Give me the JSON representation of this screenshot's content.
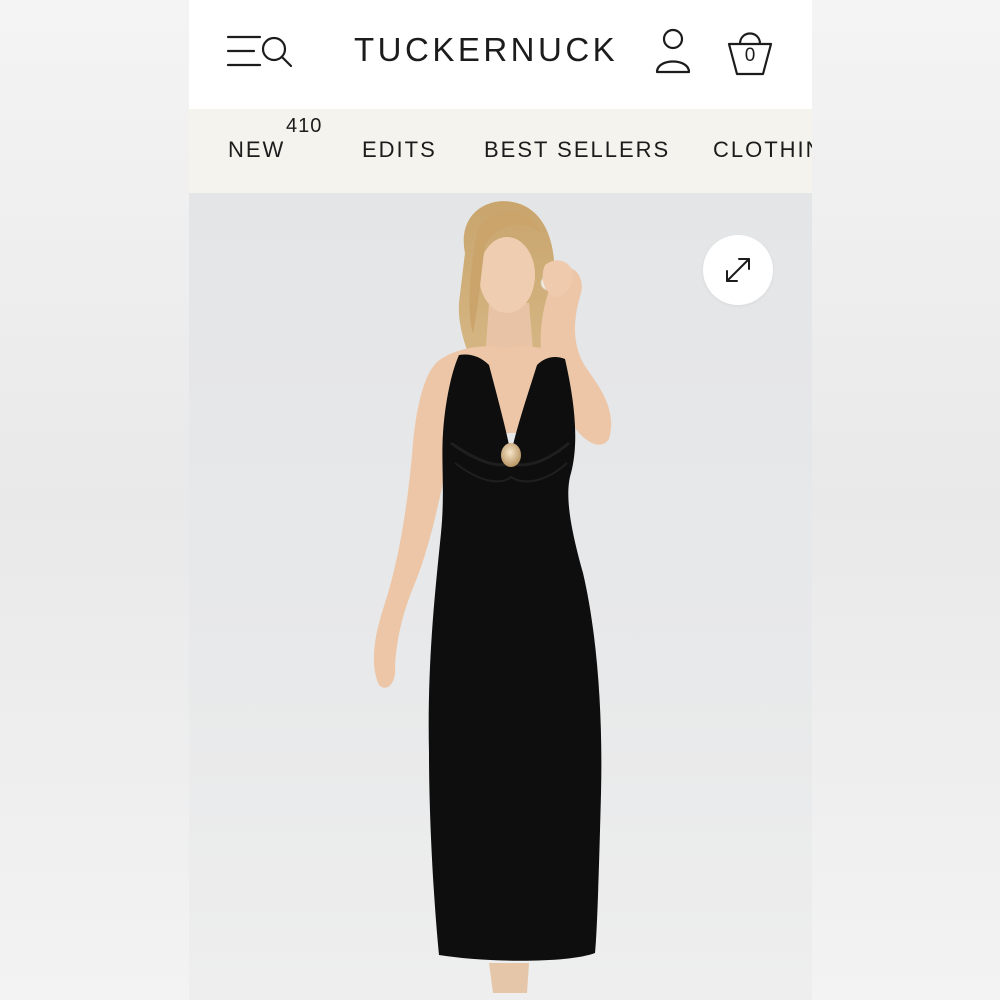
{
  "header": {
    "logo_text": "TUCKERNUCK",
    "menu_icon": "menu-search-icon",
    "account_icon": "user-icon",
    "bag_icon": "shopping-bag-icon",
    "bag_count": "0"
  },
  "nav": {
    "items": [
      {
        "label": "NEW",
        "badge": "410"
      },
      {
        "label": "EDITS"
      },
      {
        "label": "BEST SELLERS"
      },
      {
        "label": "CLOTHING"
      }
    ]
  },
  "product_image": {
    "expand_icon": "expand-arrows-icon"
  },
  "colors": {
    "nav_background": "#f4f3ee",
    "text": "#1c1c1c",
    "image_background": "#e6e7e9",
    "dress": "#0e0e0e"
  }
}
